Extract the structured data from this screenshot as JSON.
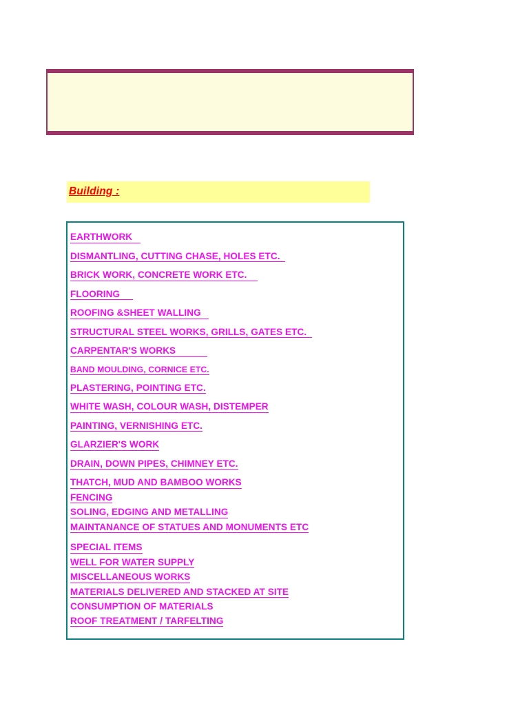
{
  "document": {
    "top_banner": {
      "text": "",
      "fill_color": "#FDFCDF",
      "rule_color": "#9C3468"
    },
    "section_heading": {
      "label": "Building :",
      "text_color": "#FF0000",
      "background_color": "#FFFF99"
    },
    "list_box": {
      "border_color": "#0C8080",
      "text_color": "#EE11EE",
      "items": [
        {
          "label": "EARTHWORK   ",
          "underlined": true,
          "spacing": "first",
          "small": false
        },
        {
          "label": "DISMANTLING, CUTTING CHASE, HOLES ETC.  ",
          "underlined": true,
          "spacing": "loose",
          "small": false
        },
        {
          "label": "BRICK WORK, CONCRETE WORK ETC.    ",
          "underlined": true,
          "spacing": "loose",
          "small": false
        },
        {
          "label": "FLOORING     ",
          "underlined": true,
          "spacing": "loose",
          "small": false
        },
        {
          "label": "ROOFING &SHEET WALLING   ",
          "underlined": true,
          "spacing": "loose",
          "small": false
        },
        {
          "label": "STRUCTURAL STEEL WORKS, GRILLS, GATES ETC.  ",
          "underlined": true,
          "spacing": "loose",
          "small": false
        },
        {
          "label": "CARPENTAR'S WORKS            ",
          "underlined": true,
          "spacing": "loose",
          "small": false
        },
        {
          "label": "BAND MOULDING, CORNICE ETC.",
          "underlined": true,
          "spacing": "loose",
          "small": true
        },
        {
          "label": "PLASTERING, POINTING ETC.",
          "underlined": true,
          "spacing": "loose",
          "small": false
        },
        {
          "label": "WHITE WASH, COLOUR WASH, DISTEMPER",
          "underlined": true,
          "spacing": "loose",
          "small": false
        },
        {
          "label": "PAINTING, VERNISHING ETC.",
          "underlined": true,
          "spacing": "loose",
          "small": false
        },
        {
          "label": "GLARZIER'S WORK",
          "underlined": true,
          "spacing": "loose",
          "small": false
        },
        {
          "label": "DRAIN, DOWN PIPES, CHIMNEY ETC.",
          "underlined": true,
          "spacing": "loose",
          "small": false
        },
        {
          "label": "THATCH, MUD AND BAMBOO WORKS",
          "underlined": true,
          "spacing": "loose",
          "small": false
        },
        {
          "label": "FENCING",
          "underlined": true,
          "spacing": "tight",
          "small": false
        },
        {
          "label": "SOLING, EDGING AND METALLING",
          "underlined": true,
          "spacing": "tight",
          "small": false
        },
        {
          "label": "MAINTANANCE OF STATUES AND MONUMENTS ETC",
          "underlined": true,
          "spacing": "tight",
          "small": false
        },
        {
          "label": "SPECIAL ITEMS",
          "underlined": true,
          "spacing": "gap",
          "small": false
        },
        {
          "label": "WELL FOR WATER SUPPLY",
          "underlined": true,
          "spacing": "tight",
          "small": false
        },
        {
          "label": "MISCELLANEOUS WORKS",
          "underlined": true,
          "spacing": "tight",
          "small": false
        },
        {
          "label": "MATERIALS DELIVERED AND STACKED AT SITE",
          "underlined": true,
          "spacing": "tight",
          "small": false
        },
        {
          "label": "CONSUMPTION OF MATERIALS",
          "underlined": false,
          "spacing": "tight",
          "small": false
        },
        {
          "label": "ROOF TREATMENT / TARFELTING",
          "underlined": true,
          "spacing": "tight",
          "small": false
        }
      ]
    }
  }
}
